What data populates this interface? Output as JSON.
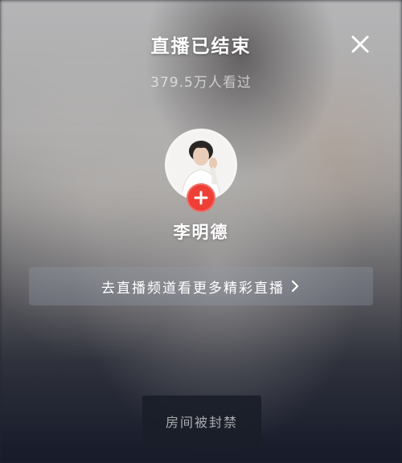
{
  "header": {
    "title": "直播已结束",
    "viewers": "379.5万人看过",
    "close_icon": "close-icon"
  },
  "streamer": {
    "name": "李明德",
    "avatar_icon": "avatar-photo",
    "follow_icon": "plus-icon",
    "follow_color": "#ee3f36"
  },
  "channel_link": {
    "label": "去直播频道看更多精彩直播",
    "icon": "chevron-right-icon"
  },
  "status": {
    "banned_label": "房间被封禁"
  }
}
